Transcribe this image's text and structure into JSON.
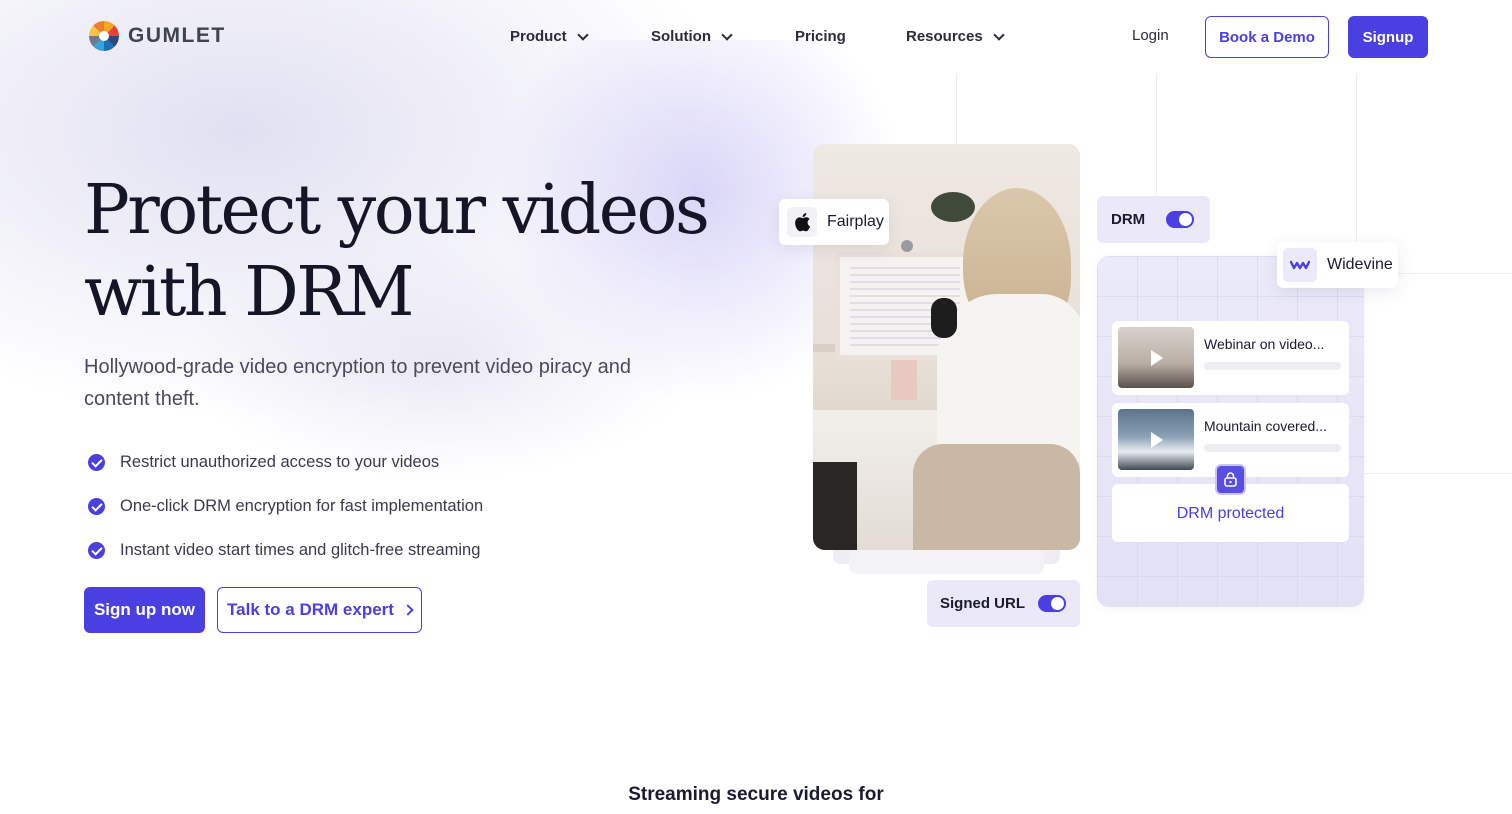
{
  "nav": {
    "logo_text": "GUMLET",
    "items": [
      {
        "label": "Product",
        "has_dropdown": true
      },
      {
        "label": "Solution",
        "has_dropdown": true
      },
      {
        "label": "Pricing",
        "has_dropdown": false
      },
      {
        "label": "Resources",
        "has_dropdown": true
      }
    ],
    "login": "Login",
    "book_demo": "Book a Demo",
    "signup": "Signup"
  },
  "hero": {
    "title_line1": "Protect your videos",
    "title_line2": "with DRM",
    "subtitle": "Hollywood-grade video encryption to prevent video piracy and content theft.",
    "features": [
      "Restrict unauthorized access to your videos",
      "One-click DRM encryption for fast implementation",
      "Instant video start times and glitch-free streaming"
    ],
    "cta_primary": "Sign up now",
    "cta_secondary": "Talk to a DRM expert"
  },
  "illustration": {
    "fairplay_label": "Fairplay",
    "drm_label": "DRM",
    "drm_enabled": true,
    "widevine_label": "Widevine",
    "videos": [
      {
        "title": "Webinar on video..."
      },
      {
        "title": "Mountain covered..."
      }
    ],
    "drm_protected_label": "DRM protected",
    "signed_url_label": "Signed URL",
    "signed_url_enabled": true
  },
  "section_heading": "Streaming secure videos for",
  "colors": {
    "accent": "#4a3fe0",
    "text_dark": "#1b1b2f",
    "panel_bg": "#ebe9f9"
  },
  "icons": [
    "gumlet-logo-icon",
    "chevron-down-icon",
    "check-circle-icon",
    "chevron-right-icon",
    "apple-icon",
    "widevine-icon",
    "play-icon",
    "lock-icon"
  ]
}
